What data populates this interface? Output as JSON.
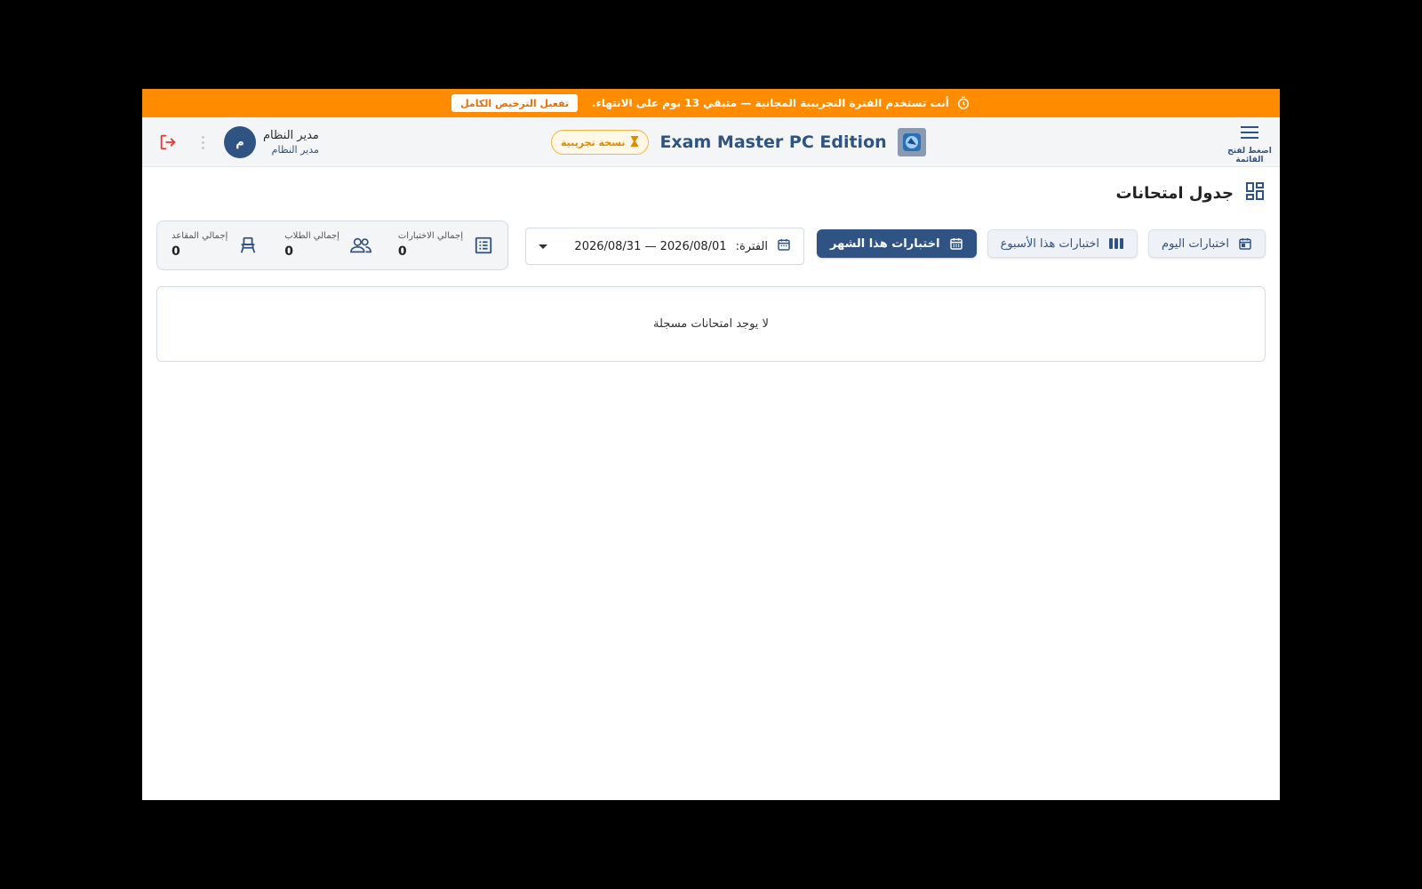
{
  "banner": {
    "message": "أنت تستخدم الفترة التجريبية المجانية — متبقي 13 يوم على الانتهاء.",
    "activate_label": "تفعيل الترخيص الكامل",
    "icon": "timer-icon",
    "color": "#ff8c00"
  },
  "header": {
    "menu_caption": "اضغط لفتح القائمة",
    "app_title": "Exam Master PC Edition",
    "trial_badge": "نسخة تجريبية",
    "user": {
      "name": "مدير النظام",
      "role": "مدير النظام",
      "avatar_initial": "م"
    }
  },
  "page": {
    "title": "جدول امتحانات",
    "icon": "dashboard-icon"
  },
  "toolbar": {
    "today_label": "اختبارات اليوم",
    "week_label": "اختبارات هذا الأسبوع",
    "month_label": "اختبارات هذا الشهر",
    "active": "month"
  },
  "period": {
    "prefix": "الفترة:",
    "value": "2026/08/01 — 2026/08/31"
  },
  "stats": [
    {
      "label": "إجمالي الاختبارات",
      "value": "0",
      "icon": "list-icon"
    },
    {
      "label": "إجمالي الطلاب",
      "value": "0",
      "icon": "people-icon"
    },
    {
      "label": "إجمالي المقاعد",
      "value": "0",
      "icon": "seat-icon"
    }
  ],
  "empty_message": "لا يوجد امتحانات مسجلة",
  "colors": {
    "primary": "#2f5382",
    "banner": "#ff8c00",
    "logout": "#e53935"
  }
}
